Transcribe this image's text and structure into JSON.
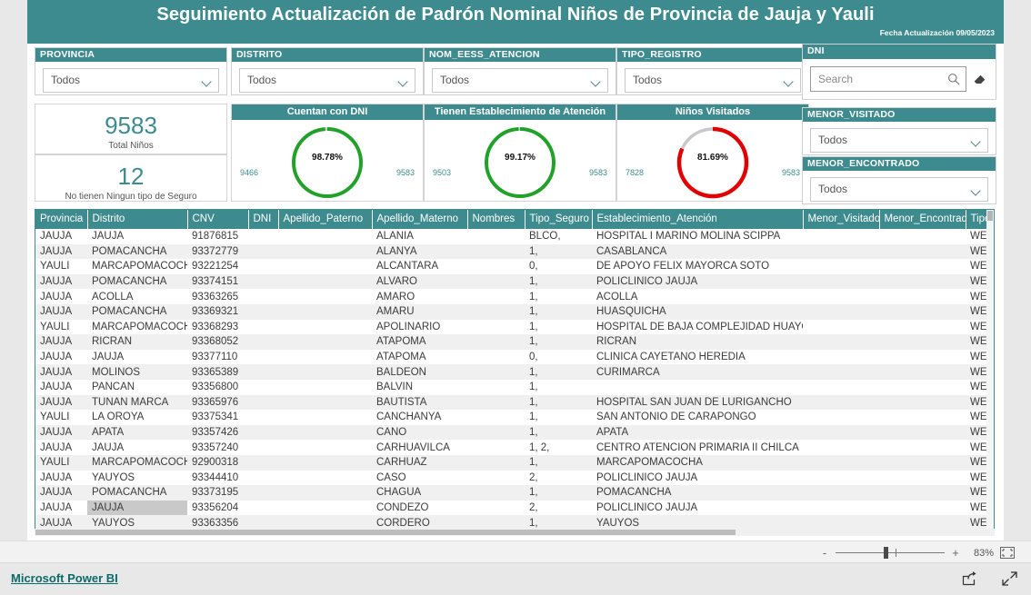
{
  "header": {
    "title": "Seguimiento Actualización de Padrón Nominal Niños de Provincia de Jauja y Yauli",
    "date_label": "Fecha Actualización 09/05/2023",
    "bg_color": "#3e8b8f"
  },
  "slicers": [
    {
      "label": "PROVINCIA",
      "value": "Todos"
    },
    {
      "label": "DISTRITO",
      "value": "Todos"
    },
    {
      "label": "NOM_EESS_ATENCION",
      "value": "Todos"
    },
    {
      "label": "TIPO_REGISTRO",
      "value": "Todos"
    },
    {
      "label": "MENOR_VISITADO",
      "value": "Todos"
    },
    {
      "label": "MENOR_ENCONTRADO",
      "value": "Todos"
    }
  ],
  "dni_search": {
    "label": "DNI",
    "placeholder": "Search",
    "value": "",
    "search_icon": "search-icon",
    "eraser_icon": "eraser-icon"
  },
  "cards": [
    {
      "value": "9583",
      "label": "Total Niños"
    },
    {
      "value": "12",
      "label": "No tienen Ningun tipo de Seguro"
    }
  ],
  "chart_data": [
    {
      "type": "pie",
      "title": "Cuentan con DNI",
      "percent_label": "98.78%",
      "percent": 98.78,
      "min_label": "9466",
      "max_label": "9583",
      "value": 9466,
      "total": 9583,
      "arc_color": "#22a12a",
      "track_color": "#c8c8c8"
    },
    {
      "type": "pie",
      "title": "Tienen Establecimiento de Atención",
      "percent_label": "99.17%",
      "percent": 99.17,
      "min_label": "9503",
      "max_label": "9583",
      "value": 9503,
      "total": 9583,
      "arc_color": "#22a12a",
      "track_color": "#c8c8c8"
    },
    {
      "type": "pie",
      "title": "Niños Visitados",
      "percent_label": "81.69%",
      "percent": 81.69,
      "min_label": "7828",
      "max_label": "9583",
      "value": 7828,
      "total": 9583,
      "arc_color": "#e00000",
      "track_color": "#c8c8c8"
    }
  ],
  "table": {
    "columns": [
      "Provincia",
      "Distrito",
      "CNV",
      "DNI",
      "Apellido_Paterno",
      "Apellido_Materno",
      "Nombres",
      "Tipo_Seguro",
      "Establecimiento_Atención",
      "Menor_Visitado",
      "Menor_Encontrado",
      "Tipo_Registro"
    ],
    "rows": [
      [
        "JAUJA",
        "JAUJA",
        "91876815",
        "",
        "",
        "ALANIA",
        "",
        "BLCO,",
        "HOSPITAL I MARINO MOLINA SCIPPA",
        "",
        "",
        "WEB SERVIC"
      ],
      [
        "JAUJA",
        "POMACANCHA",
        "93372779",
        "",
        "",
        "ALANYA",
        "",
        "1,",
        "CASABLANCA",
        "",
        "",
        "WEB SERVIC"
      ],
      [
        "YAULI",
        "MARCAPOMACOCHA",
        "93221254",
        "",
        "",
        "ALCANTARA",
        "",
        "0,",
        "DE APOYO FELIX MAYORCA SOTO",
        "",
        "",
        "WEB SERVIC"
      ],
      [
        "JAUJA",
        "POMACANCHA",
        "93374151",
        "",
        "",
        "ALVARO",
        "",
        "1,",
        "POLICLINICO JAUJA",
        "",
        "",
        "WEB SERVIC"
      ],
      [
        "JAUJA",
        "ACOLLA",
        "93363265",
        "",
        "",
        "AMARO",
        "",
        "1,",
        "ACOLLA",
        "",
        "",
        "WEB SERVIC"
      ],
      [
        "JAUJA",
        "POMACANCHA",
        "93369321",
        "",
        "",
        "AMARU",
        "",
        "1,",
        "HUASQUICHA",
        "",
        "",
        "WEB SERVIC"
      ],
      [
        "YAULI",
        "MARCAPOMACOCHA",
        "93368293",
        "",
        "",
        "APOLINARIO",
        "",
        "1,",
        "HOSPITAL DE BAJA COMPLEJIDAD HUAYCAN",
        "",
        "",
        "WEB SERVIC"
      ],
      [
        "JAUJA",
        "RICRAN",
        "93368052",
        "",
        "",
        "ATAPOMA",
        "",
        "1,",
        "RICRAN",
        "",
        "",
        "WEB SERVIC"
      ],
      [
        "JAUJA",
        "JAUJA",
        "93377110",
        "",
        "",
        "ATAPOMA",
        "",
        "0,",
        "CLINICA CAYETANO HEREDIA",
        "",
        "",
        "WEB SERVIC"
      ],
      [
        "JAUJA",
        "MOLINOS",
        "93365389",
        "",
        "",
        "BALDEON",
        "",
        "1,",
        "CURIMARCA",
        "",
        "",
        "WEB SERVIC"
      ],
      [
        "JAUJA",
        "PANCAN",
        "93356800",
        "",
        "",
        "BALVIN",
        "",
        "1,",
        "",
        "",
        "",
        "WEB SERVIC"
      ],
      [
        "JAUJA",
        "TUNAN MARCA",
        "93365976",
        "",
        "",
        "BAUTISTA",
        "",
        "1,",
        "HOSPITAL SAN JUAN DE LURIGANCHO",
        "",
        "",
        "WEB SERVIC"
      ],
      [
        "YAULI",
        "LA OROYA",
        "93375341",
        "",
        "",
        "CANCHANYA",
        "",
        "1,",
        "SAN ANTONIO DE CARAPONGO",
        "",
        "",
        "WEB SERVIC"
      ],
      [
        "JAUJA",
        "APATA",
        "93357426",
        "",
        "",
        "CANO",
        "",
        "1,",
        "APATA",
        "",
        "",
        "WEB SERVIC"
      ],
      [
        "JAUJA",
        "JAUJA",
        "93357240",
        "",
        "",
        "CARHUAVILCA",
        "",
        "1, 2,",
        "CENTRO ATENCION PRIMARIA II CHILCA",
        "",
        "",
        "WEB SERVIC"
      ],
      [
        "YAULI",
        "MARCAPOMACOCHA",
        "92900318",
        "",
        "",
        "CARHUAZ",
        "",
        "1,",
        "MARCAPOMACOCHA",
        "",
        "",
        "WEB SERVIC"
      ],
      [
        "JAUJA",
        "YAUYOS",
        "93344410",
        "",
        "",
        "CASO",
        "",
        "2,",
        "POLICLINICO JAUJA",
        "",
        "",
        "WEB SERVIC"
      ],
      [
        "JAUJA",
        "POMACANCHA",
        "93373195",
        "",
        "",
        "CHAGUA",
        "",
        "1,",
        "POMACANCHA",
        "",
        "",
        "WEB SERVIC"
      ],
      [
        "JAUJA",
        "JAUJA",
        "93356204",
        "",
        "",
        "CONDEZO",
        "",
        "2,",
        "POLICLINICO JAUJA",
        "",
        "",
        "WEB SERVIC"
      ],
      [
        "JAUJA",
        "YAUYOS",
        "93363356",
        "",
        "",
        "CORDERO",
        "",
        "1,",
        "YAUYOS",
        "",
        "",
        "WEB SERVIC"
      ]
    ],
    "highlighted_cell": {
      "row": 18,
      "col": 1
    }
  },
  "bottom_bar": {
    "zoom_out_label": "-",
    "zoom_in_label": "+",
    "zoom_level": "83%",
    "fit_icon": "fit-to-page-icon"
  },
  "footer": {
    "link_label": "Microsoft Power BI",
    "share_icon": "share-icon",
    "fullscreen_icon": "fullscreen-icon"
  }
}
